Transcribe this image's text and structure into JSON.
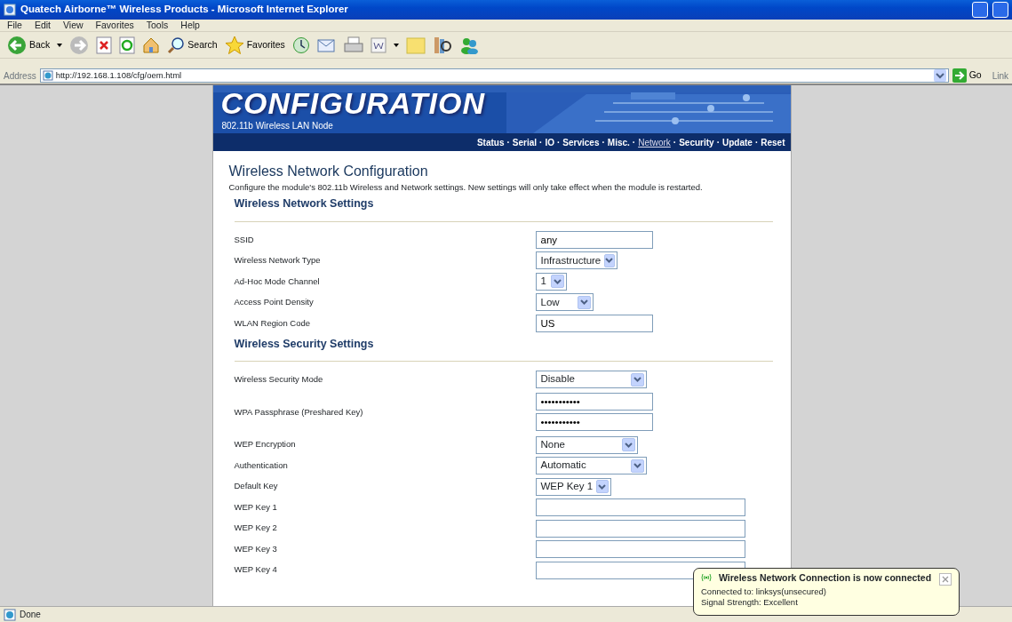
{
  "window": {
    "title": "Quatech Airborne™ Wireless Products - Microsoft Internet Explorer"
  },
  "menu": [
    "File",
    "Edit",
    "View",
    "Favorites",
    "Tools",
    "Help"
  ],
  "toolbar": {
    "back": "Back",
    "search": "Search",
    "favorites": "Favorites"
  },
  "address_bar": {
    "label": "Address",
    "url": "http://192.168.1.108/cfg/oem.html",
    "go": "Go",
    "links": "Link"
  },
  "banner": {
    "title": "CONFIGURATION",
    "subtitle": "802.11b Wireless LAN Node"
  },
  "nav": [
    {
      "label": "Status",
      "selected": false
    },
    {
      "label": "Serial",
      "selected": false
    },
    {
      "label": "IO",
      "selected": false
    },
    {
      "label": "Services",
      "selected": false
    },
    {
      "label": "Misc.",
      "selected": false
    },
    {
      "label": "Network",
      "selected": true
    },
    {
      "label": "Security",
      "selected": false
    },
    {
      "label": "Update",
      "selected": false
    },
    {
      "label": "Reset",
      "selected": false
    }
  ],
  "nav_separators": [
    "·",
    "·",
    "·",
    "·",
    "·",
    "·",
    "·",
    "·"
  ],
  "page": {
    "heading": "Wireless Network Configuration",
    "description": "Configure the module's 802.11b Wireless and Network settings. New settings will only take effect when the module is restarted."
  },
  "sections": [
    {
      "title": "Wireless Network Settings",
      "fields": [
        {
          "label": "SSID",
          "kind": "text",
          "value": "any"
        },
        {
          "label": "Wireless Network Type",
          "kind": "select",
          "value": "Infrastructure"
        },
        {
          "label": "Ad-Hoc Mode Channel",
          "kind": "select",
          "value": "1"
        },
        {
          "label": "Access Point Density",
          "kind": "select",
          "value": "Low"
        },
        {
          "label": "WLAN Region Code",
          "kind": "text",
          "value": "US"
        }
      ]
    },
    {
      "title": "Wireless Security Settings",
      "fields": [
        {
          "label": "Wireless Security Mode",
          "kind": "select",
          "value": "Disable"
        },
        {
          "label": "WPA Passphrase (Preshared Key)",
          "kind": "password2",
          "values": [
            "•••••••••••",
            "•••••••••••"
          ]
        },
        {
          "label": "WEP Encryption",
          "kind": "select",
          "value": "None"
        },
        {
          "label": "Authentication",
          "kind": "select",
          "value": "Automatic"
        },
        {
          "label": "Default Key",
          "kind": "select",
          "value": "WEP Key 1"
        },
        {
          "label": "WEP Key 1",
          "kind": "key"
        },
        {
          "label": "WEP Key 2",
          "kind": "key"
        },
        {
          "label": "WEP Key 3",
          "kind": "key"
        },
        {
          "label": "WEP Key 4",
          "kind": "key"
        }
      ]
    }
  ],
  "notification": {
    "title": "Wireless Network Connection is now connected",
    "lines": [
      "Connected to: linksys(unsecured)",
      "Signal Strength: Excellent"
    ]
  },
  "status_bar": {
    "text": "Done"
  }
}
